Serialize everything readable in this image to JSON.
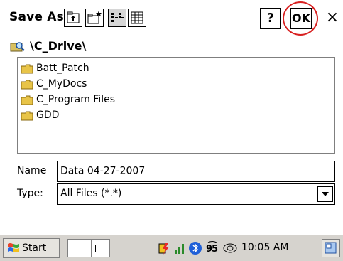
{
  "dialog": {
    "title": "Save As",
    "help_label": "?",
    "ok_label": "OK",
    "close_label": "×"
  },
  "path": {
    "text": "\\C_Drive\\"
  },
  "files": [
    {
      "name": "Batt_Patch"
    },
    {
      "name": "C_MyDocs"
    },
    {
      "name": "C_Program Files"
    },
    {
      "name": "GDD"
    }
  ],
  "name_field": {
    "label": "Name",
    "value": "Data 04-27-2007"
  },
  "type_field": {
    "label": "Type:",
    "value": "All Files (*.*)"
  },
  "taskbar": {
    "start_label": "Start",
    "clock": "10:05 AM",
    "icons": [
      "battery-icon",
      "signal-icon",
      "bluetooth-icon",
      "network-icon",
      "connection-icon",
      "desktop-icon"
    ]
  },
  "colors": {
    "annotation_circle": "#d82020",
    "folder": "#e8c448",
    "taskbar": "#d6d3ce"
  }
}
